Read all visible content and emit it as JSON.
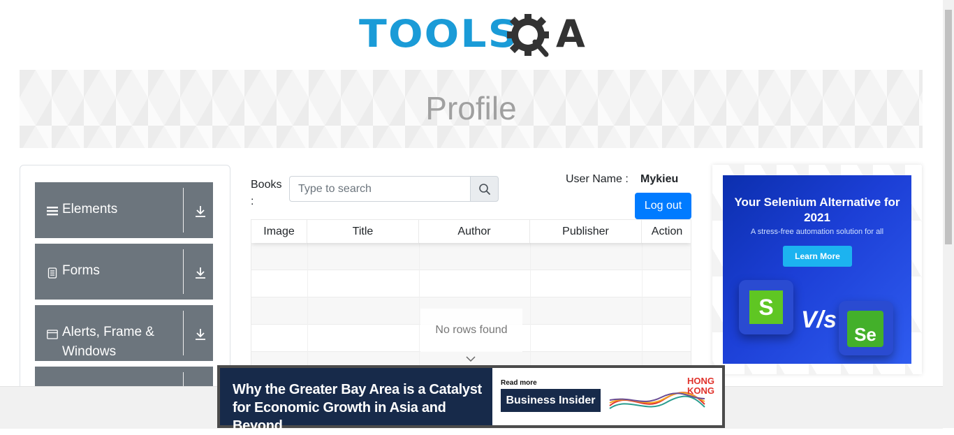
{
  "header": {
    "logo_text_blue": "TOOLS",
    "logo_text_dark": "A"
  },
  "banner": {
    "title": "Profile"
  },
  "sidebar": {
    "groups": [
      {
        "label": "Elements",
        "icon": "hamburger-icon"
      },
      {
        "label": "Forms",
        "icon": "document-icon"
      },
      {
        "label": "Alerts, Frame & Windows",
        "icon": "window-icon"
      },
      {
        "label": "",
        "icon": ""
      }
    ]
  },
  "books": {
    "label": "Books :",
    "search_placeholder": "Type to search"
  },
  "user": {
    "name_label": "User Name :",
    "name_value": "Mykieu",
    "logout_label": "Log out"
  },
  "table": {
    "columns": [
      "Image",
      "Title",
      "Author",
      "Publisher",
      "Action"
    ],
    "empty_text": "No rows found"
  },
  "right_ad": {
    "headline": "Your Selenium Alternative for 2021",
    "subtext": "A stress-free automation solution for all",
    "button": "Learn More",
    "left_logo": "S",
    "vs": "V/s",
    "right_logo": "Se"
  },
  "bottom_ad": {
    "headline": "Why the Greater Bay Area is a Catalyst for Economic Growth in Asia and Beyond",
    "read_more": "Read more",
    "brand": "Business Insider",
    "partner": "HONG KONG"
  },
  "colors": {
    "accent": "#007bff",
    "sidebar_group": "#6c757d",
    "logo_blue": "#1a9bd7"
  }
}
